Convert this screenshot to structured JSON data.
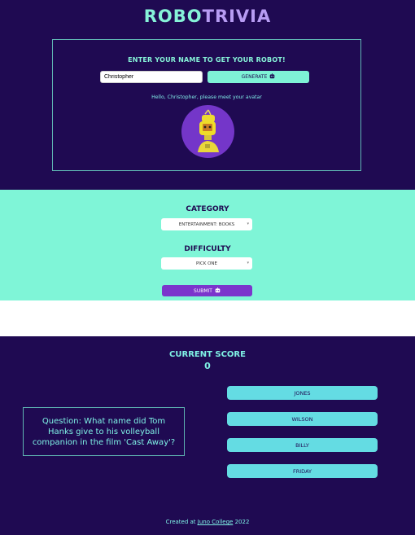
{
  "header": {
    "logo_part1": "ROBO",
    "logo_part2": "TRIVIA"
  },
  "avatar_section": {
    "title": "ENTER YOUR NAME TO GET YOUR ROBOT!",
    "name_value": "Christopher",
    "generate_label": "GENERATE",
    "generate_icon": "robot-face-icon",
    "greeting": "Hello, Christopher, please meet your avatar",
    "avatar_icon": "robot-avatar-image"
  },
  "options": {
    "category_label": "CATEGORY",
    "category_value": "ENTERTAINMENT: BOOKS",
    "difficulty_label": "DIFFICULTY",
    "difficulty_value": "PICK ONE",
    "submit_label": "SUBMIT",
    "submit_icon": "robot-face-icon"
  },
  "game": {
    "score_label": "CURRENT SCORE",
    "score_value": "0",
    "question": "Question: What name did Tom Hanks give to his volleyball companion in the film 'Cast Away'?",
    "answers": [
      "JONES",
      "WILSON",
      "BILLY",
      "FRIDAY"
    ]
  },
  "footer": {
    "prefix": "Created at",
    "link": "Juno College",
    "suffix": "2022"
  },
  "colors": {
    "navy": "#1f0a52",
    "mint": "#7ff5d7",
    "purple": "#7b35cc",
    "cyan": "#64dce3"
  }
}
